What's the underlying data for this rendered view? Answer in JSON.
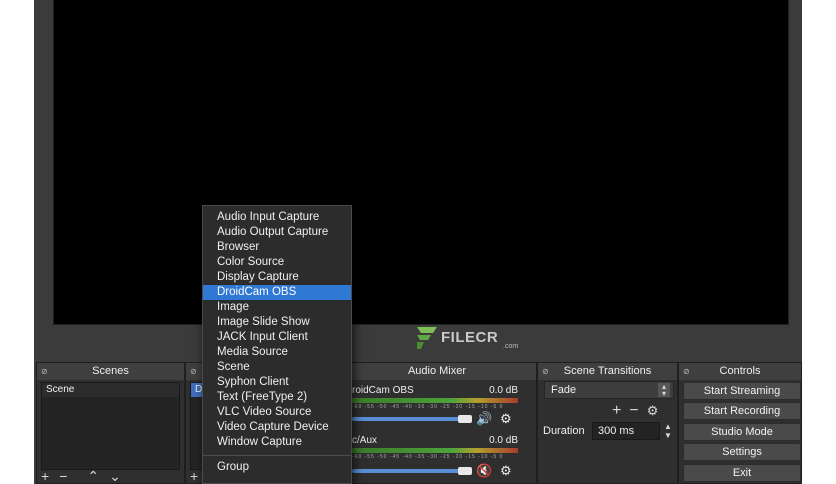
{
  "watermark": {
    "brand": "FILECR",
    "sub": ".com"
  },
  "docks": {
    "scenes": {
      "title": "Scenes",
      "items": [
        "Scene"
      ]
    },
    "sources": {
      "title": "",
      "visible_item": "Dr"
    },
    "mixer": {
      "title": "Audio Mixer",
      "channels": [
        {
          "name": "roidCam OBS",
          "db": "0.0 dB",
          "muted": false
        },
        {
          "name": "c/Aux",
          "db": "0.0 dB",
          "muted": true
        }
      ],
      "ticks": "-60 -55 -50 -45 -40 -35 -30 -25 -20 -15 -10 -5 0"
    },
    "transitions": {
      "title": "Scene Transitions",
      "selected": "Fade",
      "duration_label": "Duration",
      "duration_value": "300 ms"
    },
    "controls": {
      "title": "Controls",
      "buttons": [
        "Start Streaming",
        "Start Recording",
        "Studio Mode",
        "Settings",
        "Exit"
      ]
    }
  },
  "context_menu": {
    "items": [
      "Audio Input Capture",
      "Audio Output Capture",
      "Browser",
      "Color Source",
      "Display Capture",
      "DroidCam OBS",
      "Image",
      "Image Slide Show",
      "JACK Input Client",
      "Media Source",
      "Scene",
      "Syphon Client",
      "Text (FreeType 2)",
      "VLC Video Source",
      "Video Capture Device",
      "Window Capture"
    ],
    "group_item": "Group",
    "highlighted": "DroidCam OBS"
  },
  "colors": {
    "accent": "#2f78d4",
    "panel": "#2f2f2f",
    "preview": "#000000",
    "mute": "#d63a3a"
  }
}
